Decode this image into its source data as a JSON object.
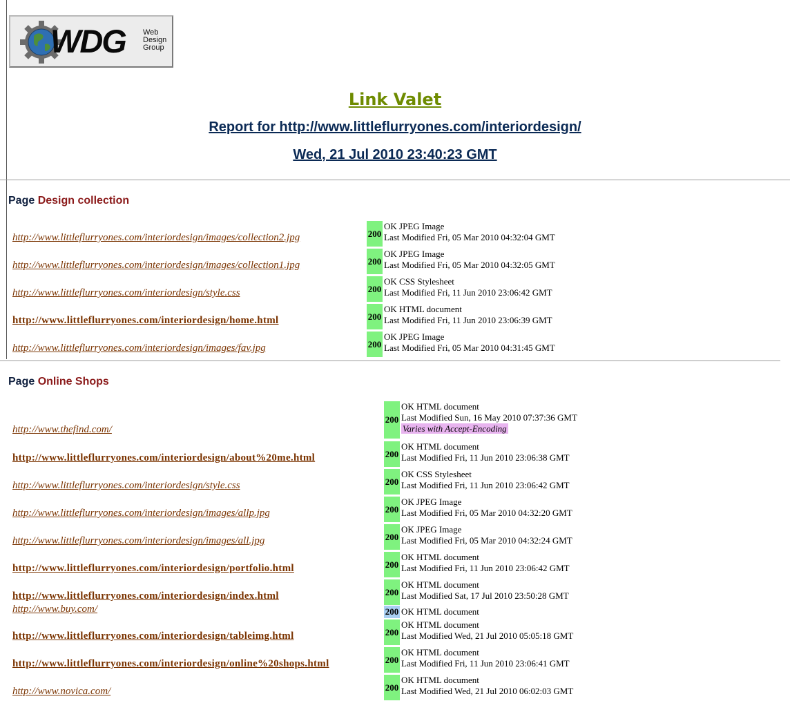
{
  "header": {
    "logo_brand": "WDG",
    "logo_sub": [
      "Web",
      "Design",
      "Group"
    ],
    "app_title": "Link Valet",
    "report": "Report for http://www.littleflurryones.com/interiordesign/",
    "date": "Wed, 21 Jul 2010 23:40:23 GMT"
  },
  "colors": {
    "ok_code": "#7ff27f",
    "cached_code": "#a9cff2",
    "vary": "#e8b4ef",
    "title": "#6e8b00",
    "link": "#7a3300"
  },
  "sections": [
    {
      "label": "Page",
      "name": "Design collection",
      "rows": [
        {
          "url": "http://www.littleflurryones.com/interiordesign/images/collection2.jpg",
          "style": "italic",
          "code": "200",
          "lines": [
            "OK JPEG Image",
            "Last Modified Fri, 05 Mar 2010 04:32:04 GMT"
          ]
        },
        {
          "url": "http://www.littleflurryones.com/interiordesign/images/collection1.jpg",
          "style": "italic",
          "code": "200",
          "lines": [
            "OK JPEG Image",
            "Last Modified Fri, 05 Mar 2010 04:32:05 GMT"
          ]
        },
        {
          "url": "http://www.littleflurryones.com/interiordesign/style.css",
          "style": "italic",
          "code": "200",
          "lines": [
            "OK CSS Stylesheet",
            "Last Modified Fri, 11 Jun 2010 23:06:42 GMT"
          ]
        },
        {
          "url": "http://www.littleflurryones.com/interiordesign/home.html",
          "style": "bold",
          "code": "200",
          "lines": [
            "OK HTML document",
            "Last Modified Fri, 11 Jun 2010 23:06:39 GMT"
          ]
        },
        {
          "url": "http://www.littleflurryones.com/interiordesign/images/fav.jpg",
          "style": "italic",
          "code": "200",
          "lines": [
            "OK JPEG Image",
            "Last Modified Fri, 05 Mar 2010 04:31:45 GMT"
          ]
        }
      ]
    },
    {
      "label": "Page",
      "name": "Online Shops",
      "rows": [
        {
          "url": "http://www.thefind.com/",
          "style": "italic",
          "code": "200",
          "lines": [
            "OK HTML document",
            "Last Modified Sun, 16 May 2010 07:37:36 GMT"
          ],
          "vary": "Varies with Accept-Encoding"
        },
        {
          "url": "http://www.littleflurryones.com/interiordesign/about%20me.html",
          "style": "bold",
          "code": "200",
          "lines": [
            "OK HTML document",
            "Last Modified Fri, 11 Jun 2010 23:06:38 GMT"
          ]
        },
        {
          "url": "http://www.littleflurryones.com/interiordesign/style.css",
          "style": "italic",
          "code": "200",
          "lines": [
            "OK CSS Stylesheet",
            "Last Modified Fri, 11 Jun 2010 23:06:42 GMT"
          ]
        },
        {
          "url": "http://www.littleflurryones.com/interiordesign/images/allp.jpg",
          "style": "italic",
          "code": "200",
          "lines": [
            "OK JPEG Image",
            "Last Modified Fri, 05 Mar 2010 04:32:20 GMT"
          ]
        },
        {
          "url": "http://www.littleflurryones.com/interiordesign/images/all.jpg",
          "style": "italic",
          "code": "200",
          "lines": [
            "OK JPEG Image",
            "Last Modified Fri, 05 Mar 2010 04:32:24 GMT"
          ]
        },
        {
          "url": "http://www.littleflurryones.com/interiordesign/portfolio.html",
          "style": "bold",
          "code": "200",
          "lines": [
            "OK HTML document",
            "Last Modified Fri, 11 Jun 2010 23:06:42 GMT"
          ]
        },
        {
          "url": "http://www.littleflurryones.com/interiordesign/index.html",
          "style": "bold",
          "code": "200",
          "lines": [
            "OK HTML document",
            "Last Modified Sat, 17 Jul 2010 23:50:28 GMT"
          ]
        },
        {
          "url": "http://www.buy.com/",
          "style": "italic",
          "code": "200",
          "code_color": "blue",
          "lines": [
            "OK HTML document"
          ]
        },
        {
          "url": "http://www.littleflurryones.com/interiordesign/tableimg.html",
          "style": "bold",
          "code": "200",
          "lines": [
            "OK HTML document",
            "Last Modified Wed, 21 Jul 2010 05:05:18 GMT"
          ]
        },
        {
          "url": "http://www.littleflurryones.com/interiordesign/online%20shops.html",
          "style": "bold",
          "code": "200",
          "lines": [
            "OK HTML document",
            "Last Modified Fri, 11 Jun 2010 23:06:41 GMT"
          ]
        },
        {
          "url": "http://www.novica.com/",
          "style": "italic",
          "code": "200",
          "lines": [
            "OK HTML document",
            "Last Modified Wed, 21 Jul 2010 06:02:03 GMT"
          ]
        }
      ]
    }
  ]
}
